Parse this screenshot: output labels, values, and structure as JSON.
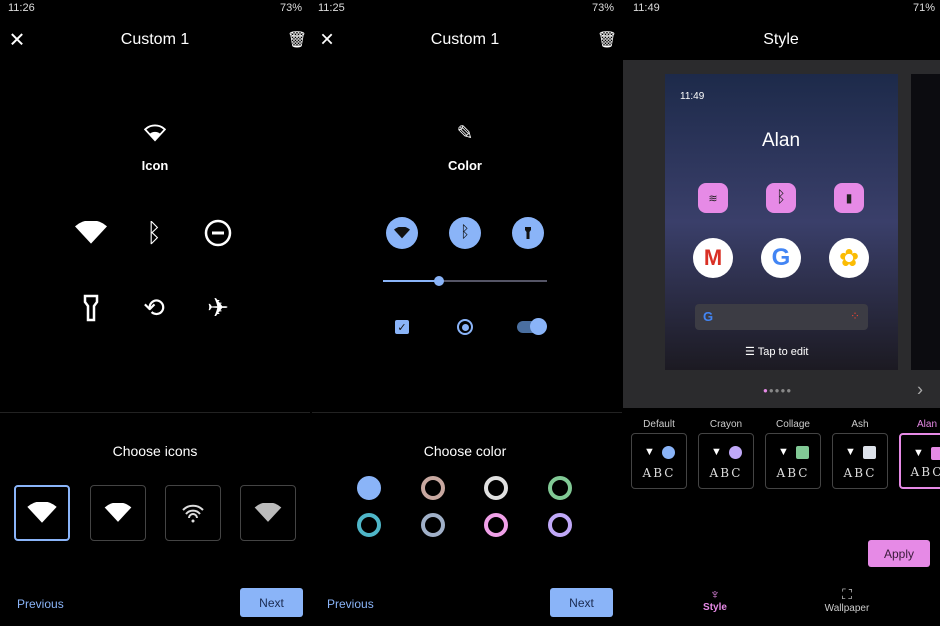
{
  "panel1": {
    "status": {
      "time": "11:26",
      "battery": "73%"
    },
    "title": "Custom 1",
    "section_label": "Icon",
    "choose_label": "Choose icons",
    "previous": "Previous",
    "next": "Next",
    "grid_icons": [
      "wifi-icon",
      "bluetooth-icon",
      "do-not-disturb-icon",
      "flashlight-icon",
      "auto-rotate-icon",
      "airplane-icon"
    ]
  },
  "panel2": {
    "status": {
      "time": "11:25",
      "battery": "73%"
    },
    "title": "Custom 1",
    "section_label": "Color",
    "choose_label": "Choose color",
    "previous": "Previous",
    "next": "Next",
    "slider_value": 0.34,
    "checkbox_checked": true,
    "toggle_on": true,
    "colors": [
      "#8ab4f8",
      "#c8a8a0",
      "#e0e0e0",
      "#81c995",
      "#4fb6c8",
      "#a0b0c8",
      "#f0a0e8",
      "#c0a8f8"
    ],
    "selected_color": "#8ab4f8"
  },
  "panel3": {
    "status": {
      "time": "11:49",
      "battery": "71%"
    },
    "title": "Style",
    "preview": {
      "time": "11:49",
      "name": "Alan",
      "edit_label": "Tap to edit"
    },
    "options": [
      {
        "label": "Default",
        "color": "#8ab4f8",
        "abc": "ABC"
      },
      {
        "label": "Crayon",
        "color": "#c0a8f8",
        "abc": "ABC"
      },
      {
        "label": "Collage",
        "color": "#81c995",
        "abc": "ABC"
      },
      {
        "label": "Ash",
        "color": "#dde2ea",
        "abc": "ABC"
      },
      {
        "label": "Alan",
        "color": "#e68ae6",
        "abc": "ABC"
      }
    ],
    "selected": "Alan",
    "apply": "Apply",
    "nav": {
      "style": "Style",
      "wallpaper": "Wallpaper"
    },
    "accent": "#e68ae6"
  }
}
